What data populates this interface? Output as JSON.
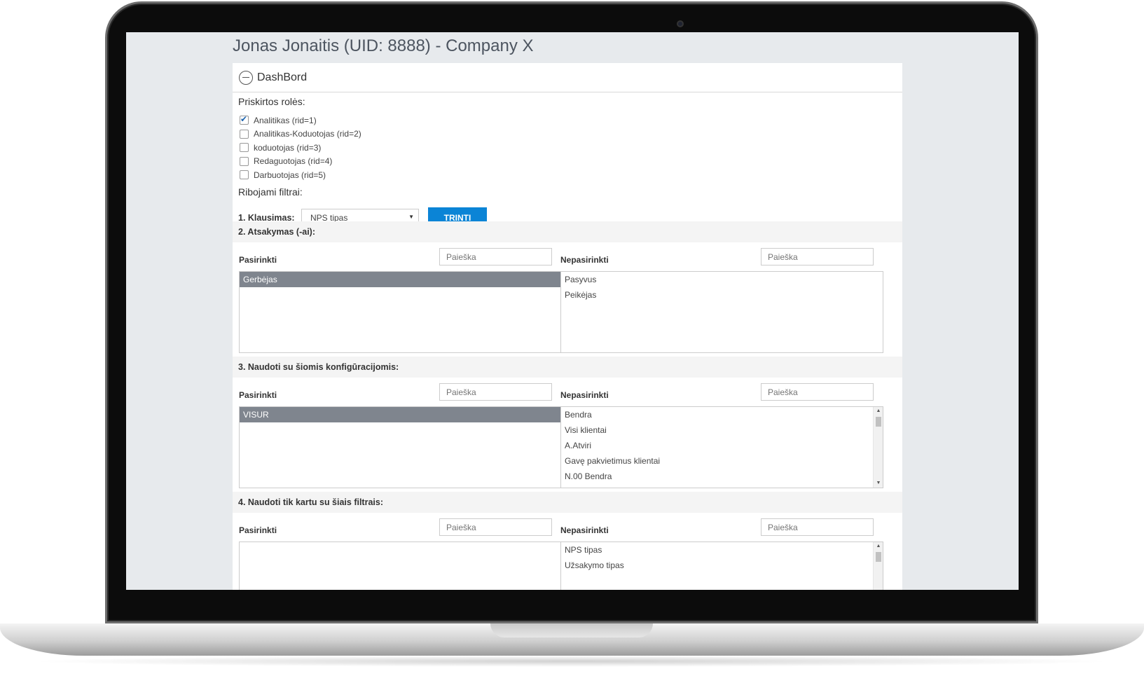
{
  "page_title": "Jonas Jonaitis (UID: 8888) - Company X",
  "panel": {
    "title": "DashBord"
  },
  "roles": {
    "label": "Priskirtos rolės:",
    "items": [
      {
        "label": "Analitikas (rid=1)",
        "checked": true
      },
      {
        "label": "Analitikas-Koduotojas (rid=2)",
        "checked": false
      },
      {
        "label": "koduotojas (rid=3)",
        "checked": false
      },
      {
        "label": "Redaguotojas (rid=4)",
        "checked": false
      },
      {
        "label": "Darbuotojas (rid=5)",
        "checked": false
      }
    ]
  },
  "filters": {
    "label": "Ribojami filtrai:",
    "q1_label": "1. Klausimas:",
    "q1_selected": "NPS tipas",
    "delete_label": "TRINTI"
  },
  "sections": [
    {
      "title": "2. Atsakymas (-ai):",
      "selected_label": "Pasirinkti",
      "unselected_label": "Nepasirinkti",
      "search_placeholder": "Paieška",
      "selected_items": [
        "Gerbėjas"
      ],
      "unselected_items": [
        "Pasyvus",
        "Peikėjas"
      ],
      "unselected_scroll": false
    },
    {
      "title": "3. Naudoti su šiomis konfigūracijomis:",
      "selected_label": "Pasirinkti",
      "unselected_label": "Nepasirinkti",
      "search_placeholder": "Paieška",
      "selected_items": [
        "VISUR"
      ],
      "unselected_items": [
        "Bendra",
        "Visi klientai",
        "A.Atviri",
        "Gavę pakvietimus klientai",
        "N.00 Bendra"
      ],
      "unselected_scroll": true
    },
    {
      "title": "4. Naudoti tik kartu su šiais filtrais:",
      "selected_label": "Pasirinkti",
      "unselected_label": "Nepasirinkti",
      "search_placeholder": "Paieška",
      "selected_items": [],
      "unselected_items": [
        "NPS tipas",
        "Užsakymo tipas"
      ],
      "unselected_scroll": true
    }
  ],
  "icons": {
    "collapse": "minus-circle-icon",
    "check": "check-icon",
    "dropdown": "caret-down-icon",
    "scroll_up": "arrow-up-icon",
    "scroll_down": "arrow-down-icon"
  },
  "colors": {
    "primary_button": "#0b84d6",
    "selected_item": "#7f858e",
    "checkmark": "#1b63ad"
  }
}
